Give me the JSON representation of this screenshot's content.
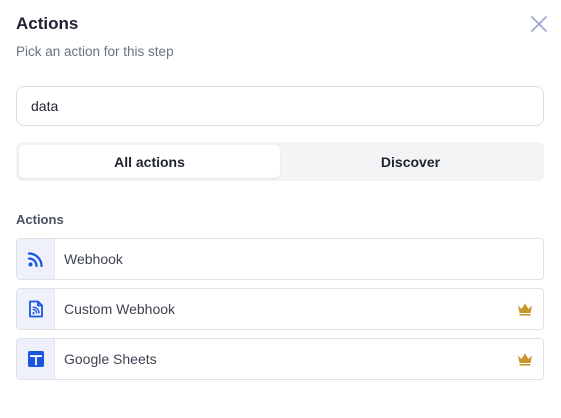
{
  "header": {
    "title": "Actions",
    "subtitle": "Pick an action for this step",
    "close_icon": "close-icon"
  },
  "search": {
    "value": "data",
    "placeholder": ""
  },
  "tabs": [
    {
      "label": "All actions",
      "active": true
    },
    {
      "label": "Discover",
      "active": false
    }
  ],
  "section": {
    "label": "Actions"
  },
  "actions": [
    {
      "label": "Webhook",
      "icon": "rss-icon",
      "premium": false
    },
    {
      "label": "Custom Webhook",
      "icon": "rss-document-icon",
      "premium": true
    },
    {
      "label": "Google Sheets",
      "icon": "google-sheets-icon",
      "premium": true
    }
  ],
  "colors": {
    "accent": "#1a56db",
    "crown": "#c9962c",
    "close": "#9aa9d6"
  }
}
